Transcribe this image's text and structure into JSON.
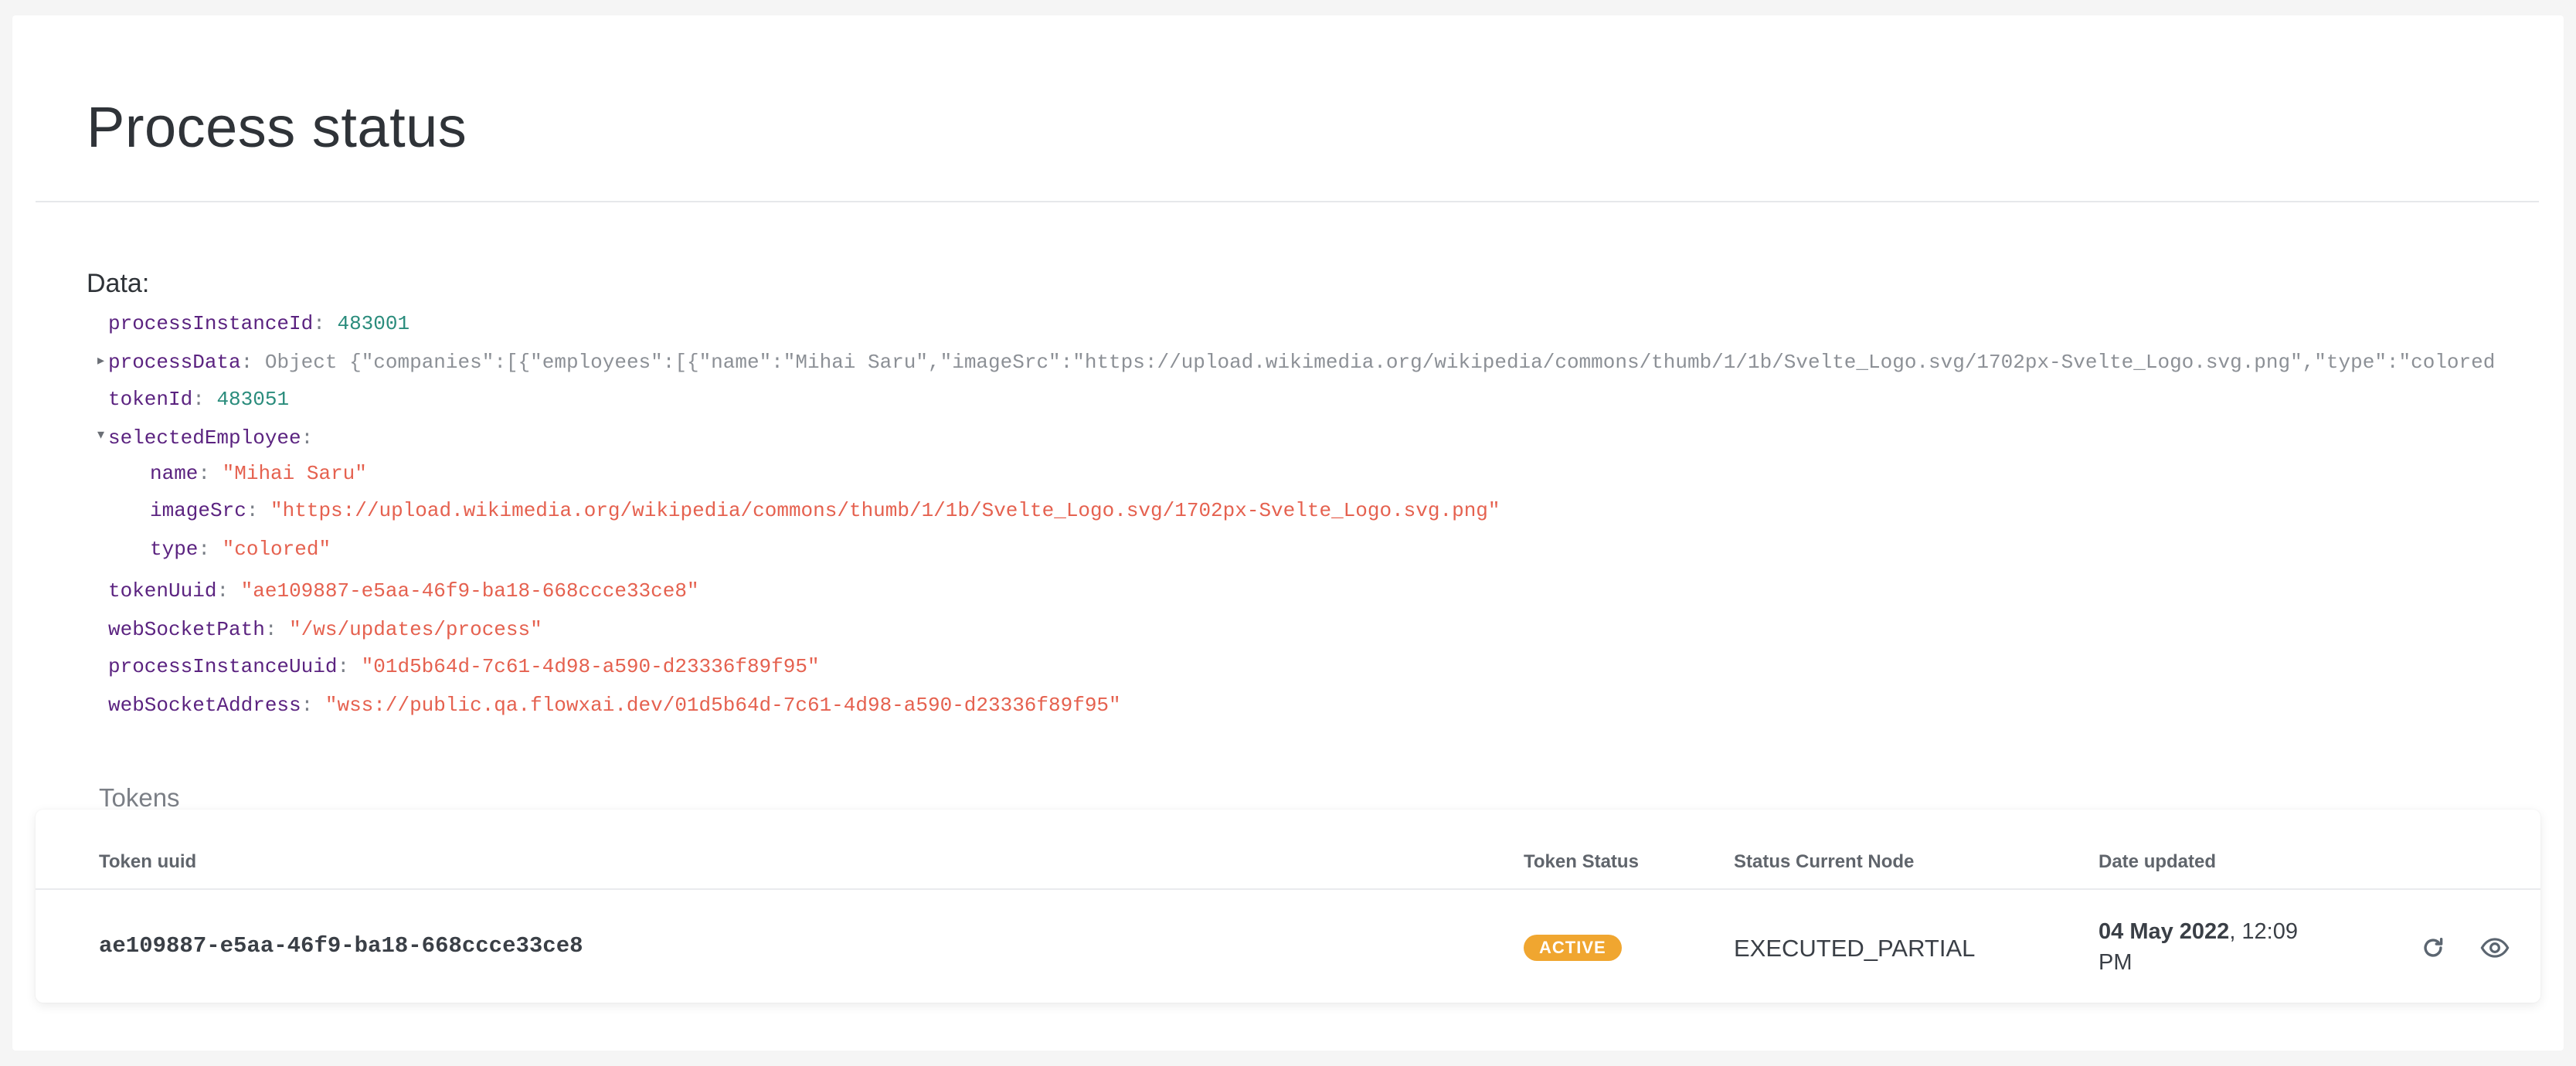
{
  "page": {
    "title": "Process status",
    "data_label": "Data:"
  },
  "data_tree": {
    "processInstanceId": {
      "key": "processInstanceId",
      "value": "483001"
    },
    "processData": {
      "key": "processData",
      "type_label": "Object",
      "preview": "{\"companies\":[{\"employees\":[{\"name\":\"Mihai Saru\",\"imageSrc\":\"https://upload.wikimedia.org/wikipedia/commons/thumb/1/1b/Svelte_Logo.svg/1702px-Svelte_Logo.svg.png\",\"type\":\"colored"
    },
    "tokenId": {
      "key": "tokenId",
      "value": "483051"
    },
    "selectedEmployee": {
      "key": "selectedEmployee",
      "name": {
        "key": "name",
        "value": "\"Mihai Saru\""
      },
      "imageSrc": {
        "key": "imageSrc",
        "value": "\"https://upload.wikimedia.org/wikipedia/commons/thumb/1/1b/Svelte_Logo.svg/1702px-Svelte_Logo.svg.png\""
      },
      "type": {
        "key": "type",
        "value": "\"colored\""
      }
    },
    "tokenUuid": {
      "key": "tokenUuid",
      "value": "\"ae109887-e5aa-46f9-ba18-668ccce33ce8\""
    },
    "webSocketPath": {
      "key": "webSocketPath",
      "value": "\"/ws/updates/process\""
    },
    "processInstanceUuid": {
      "key": "processInstanceUuid",
      "value": "\"01d5b64d-7c61-4d98-a590-d23336f89f95\""
    },
    "webSocketAddress": {
      "key": "webSocketAddress",
      "value": "\"wss://public.qa.flowxai.dev/01d5b64d-7c61-4d98-a590-d23336f89f95\""
    }
  },
  "tokens": {
    "heading": "Tokens",
    "columns": {
      "uuid": "Token uuid",
      "status": "Token Status",
      "node": "Status Current Node",
      "date": "Date updated"
    },
    "rows": [
      {
        "uuid": "ae109887-e5aa-46f9-ba18-668ccce33ce8",
        "status": "ACTIVE",
        "node": "EXECUTED_PARTIAL",
        "date_bold": "04 May 2022",
        "date_rest": ", 12:09 PM"
      }
    ]
  },
  "icons": {
    "expand_collapsed": "▸",
    "expand_open": "▾",
    "refresh": "refresh-icon",
    "view": "eye-icon"
  },
  "colors": {
    "badge_active": "#f0a630",
    "json_key": "#5b2380",
    "json_number": "#2a8c7c",
    "json_string": "#e5614f"
  }
}
